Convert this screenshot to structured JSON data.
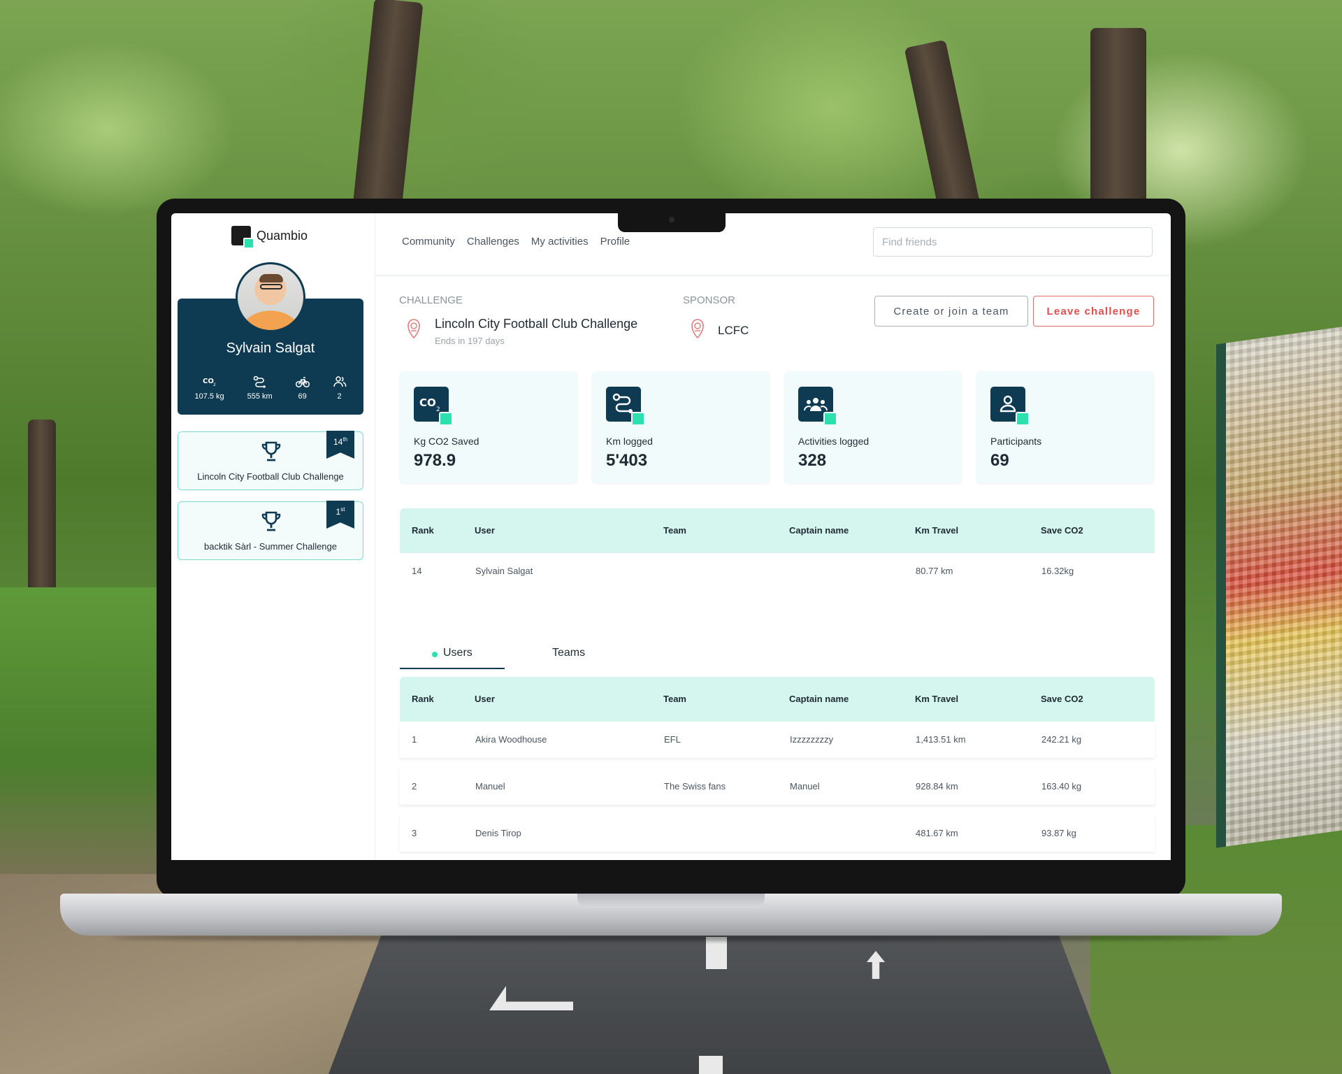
{
  "app": {
    "brand": "Quambio",
    "colors": {
      "navy": "#0f3b52",
      "accent": "#2de0b0",
      "danger": "#e04e4e",
      "header_bg": "#d5f6ef"
    }
  },
  "nav": {
    "links": [
      "Community",
      "Challenges",
      "My activities",
      "Profile"
    ],
    "search_placeholder": "Find friends"
  },
  "profile": {
    "name": "Sylvain Salgat",
    "stats": [
      {
        "icon": "co2-icon",
        "value": "107.5 kg"
      },
      {
        "icon": "route-icon",
        "value": "555 km"
      },
      {
        "icon": "bike-icon",
        "value": "69"
      },
      {
        "icon": "team-icon",
        "value": "2"
      }
    ]
  },
  "my_challenges": [
    {
      "name": "Lincoln City Football Club Challenge",
      "rank_num": "14",
      "rank_suffix": "th"
    },
    {
      "name": "backtik Sàrl - Summer Challenge",
      "rank_num": "1",
      "rank_suffix": "st"
    }
  ],
  "challenge": {
    "label": "CHALLENGE",
    "title": "Lincoln City Football Club Challenge",
    "ends": "Ends in 197 days",
    "sponsor_label": "SPONSOR",
    "sponsor": "LCFC"
  },
  "actions": {
    "team_button": "Create or join a team",
    "leave_button": "Leave challenge"
  },
  "kpis": [
    {
      "icon": "co2-icon",
      "label": "Kg CO2 Saved",
      "value": "978.9"
    },
    {
      "icon": "route-icon",
      "label": "Km logged",
      "value": "5'403"
    },
    {
      "icon": "group-icon",
      "label": "Activities logged",
      "value": "328"
    },
    {
      "icon": "person-icon",
      "label": "Participants",
      "value": "69"
    }
  ],
  "columns": [
    "Rank",
    "User",
    "Team",
    "Captain name",
    "Km Travel",
    "Save CO2"
  ],
  "my_row": {
    "rank": "14",
    "user": "Sylvain Salgat",
    "team": "",
    "captain": "",
    "km": "80.77 km",
    "co2": "16.32kg"
  },
  "tabs": [
    "Users",
    "Teams"
  ],
  "leaderboard": [
    {
      "rank": "1",
      "user": "Akira Woodhouse",
      "team": "EFL",
      "captain": "Izzzzzzzzy",
      "km": "1,413.51 km",
      "co2": "242.21 kg"
    },
    {
      "rank": "2",
      "user": "Manuel",
      "team": "The Swiss fans",
      "captain": "Manuel",
      "km": "928.84 km",
      "co2": "163.40 kg"
    },
    {
      "rank": "3",
      "user": "Denis Tirop",
      "team": "",
      "captain": "",
      "km": "481.67 km",
      "co2": "93.87 kg"
    }
  ]
}
